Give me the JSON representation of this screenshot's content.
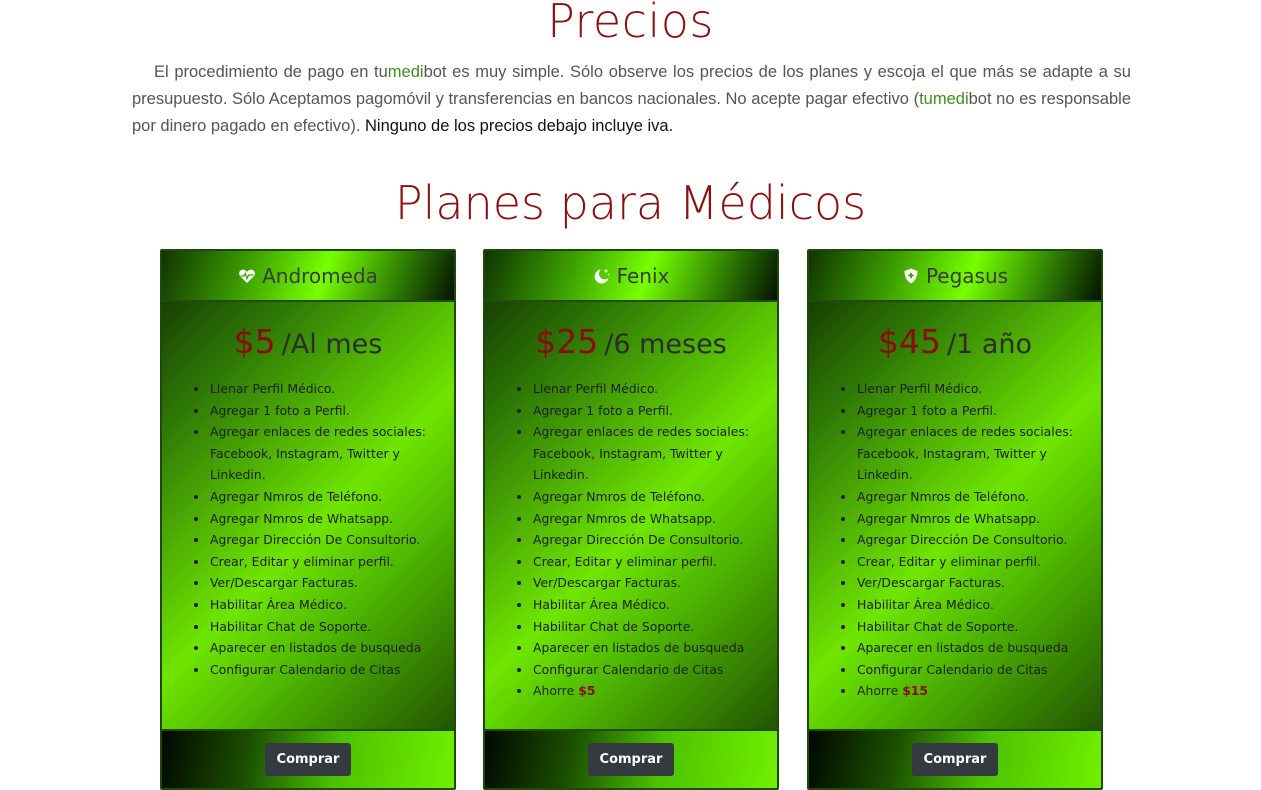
{
  "header": {
    "title": "Precios",
    "intro": {
      "part1": "El procedimiento de pago en ",
      "brand_a": "tu",
      "brand_b": "medi",
      "brand_c": "bot",
      "part2": " es muy simple. Sólo observe los precios de los planes y escoja el que más se adapte a su presupuesto. Sólo Aceptamos pagomóvil y transferencias en bancos nacionales. No acepte pagar efectivo (",
      "part3": " no es responsable por dinero pagado en efectivo). ",
      "strong": "Ninguno de los precios debajo incluye iva."
    }
  },
  "plans_section": {
    "title": "Planes para Médicos",
    "plans": [
      {
        "name": "Andromeda",
        "icon": "heart-pulse-icon",
        "amount": "$5",
        "period": "/Al mes",
        "features": [
          "Llenar Perfil Médico.",
          "Agregar 1 foto a Perfil.",
          "Agregar enlaces de redes sociales: Facebook, Instagram, Twitter y Linkedin.",
          "Agregar Nmros de Teléfono.",
          "Agregar Nmros de Whatsapp.",
          "Agregar Dirección De Consultorio.",
          "Crear, Editar y eliminar perfil.",
          "Ver/Descargar Facturas.",
          "Habilitar Área Médico.",
          "Habilitar Chat de Soporte.",
          "Aparecer en listados de busqueda",
          "Configurar Calendario de Citas"
        ],
        "savings_label": "",
        "savings_value": "",
        "button": "Comprar"
      },
      {
        "name": "Fenix",
        "icon": "moon-stars-icon",
        "amount": "$25",
        "period": "/6 meses",
        "features": [
          "Llenar Perfil Médico.",
          "Agregar 1 foto a Perfil.",
          "Agregar enlaces de redes sociales: Facebook, Instagram, Twitter y Linkedin.",
          "Agregar Nmros de Teléfono.",
          "Agregar Nmros de Whatsapp.",
          "Agregar Dirección De Consultorio.",
          "Crear, Editar y eliminar perfil.",
          "Ver/Descargar Facturas.",
          "Habilitar Área Médico.",
          "Habilitar Chat de Soporte.",
          "Aparecer en listados de busqueda",
          "Configurar Calendario de Citas"
        ],
        "savings_label": "Ahorre",
        "savings_value": "$5",
        "button": "Comprar"
      },
      {
        "name": "Pegasus",
        "icon": "shield-plus-icon",
        "amount": "$45",
        "period": "/1 año",
        "features": [
          "Llenar Perfil Médico.",
          "Agregar 1 foto a Perfil.",
          "Agregar enlaces de redes sociales: Facebook, Instagram, Twitter y Linkedin.",
          "Agregar Nmros de Teléfono.",
          "Agregar Nmros de Whatsapp.",
          "Agregar Dirección De Consultorio.",
          "Crear, Editar y eliminar perfil.",
          "Ver/Descargar Facturas.",
          "Habilitar Área Médico.",
          "Habilitar Chat de Soporte.",
          "Aparecer en listados de busqueda",
          "Configurar Calendario de Citas"
        ],
        "savings_label": "Ahorre",
        "savings_value": "$15",
        "button": "Comprar"
      }
    ]
  },
  "colors": {
    "title_red": "#8b1010",
    "price_red": "#8b0c0c",
    "brand_green": "#3e8e22",
    "card_green": "#6fe600",
    "button_dark": "#343a40"
  }
}
